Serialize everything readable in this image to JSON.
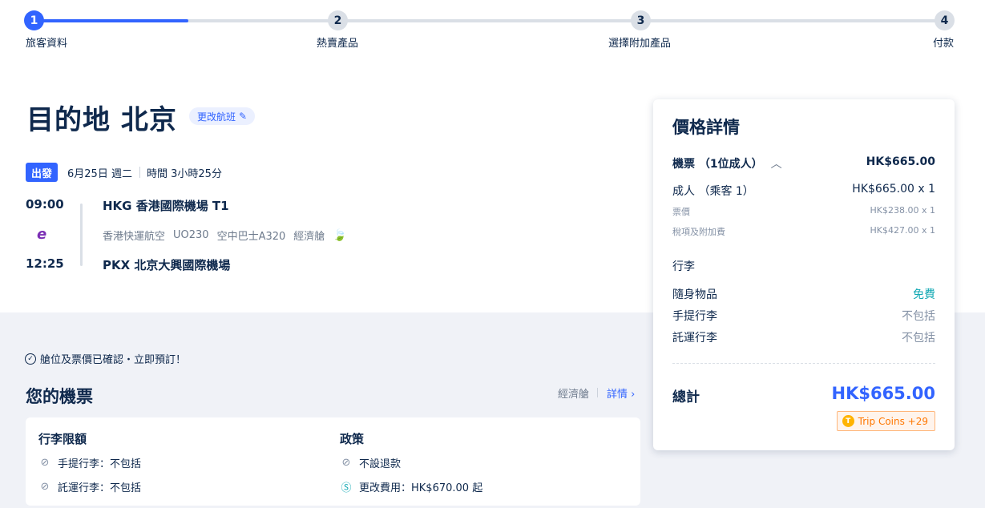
{
  "stepper": {
    "steps": [
      {
        "num": "1",
        "label": "旅客資料"
      },
      {
        "num": "2",
        "label": "熱賣產品"
      },
      {
        "num": "3",
        "label": "選擇附加產品"
      },
      {
        "num": "4",
        "label": "付款"
      }
    ],
    "progress": 0.17
  },
  "destination": {
    "title": "目的地 北京",
    "change_label": "更改航班"
  },
  "flight": {
    "depart_badge": "出發",
    "date": "6月25日 週二",
    "duration": "時間 3小時25分",
    "dep_time": "09:00",
    "arr_time": "12:25",
    "dep_airport": "HKG 香港國際機場 T1",
    "arr_airport": "PKX 北京大興國際機場",
    "airline": "香港快運航空",
    "flight_no": "UO230",
    "aircraft": "空中巴士A320",
    "cabin": "經濟艙",
    "airline_logo_text": "e"
  },
  "confirm_text": "艙位及票價已確認・立即預訂！",
  "ticket": {
    "title": "您的機票",
    "cabin": "經濟艙",
    "details_link": "詳情",
    "baggage_title": "行李限額",
    "carry_on": "手提行李：不包括",
    "checked": "託運行李：不包括",
    "policy_title": "政策",
    "refund": "不設退款",
    "change_fee": "更改費用：HK$670.00 起"
  },
  "price": {
    "title": "價格詳情",
    "ticket_label": "機票 （1位成人）",
    "ticket_total": "HK$665.00",
    "adult_label": "成人 （乘客 1）",
    "adult_value": "HK$665.00 x 1",
    "fare_label": "票價",
    "fare_value": "HK$238.00 x 1",
    "tax_label": "稅項及附加費",
    "tax_value": "HK$427.00 x 1",
    "baggage_label": "行李",
    "personal_item": "隨身物品",
    "personal_value": "免費",
    "carry_on": "手提行李",
    "carry_value": "不包括",
    "checked": "託運行李",
    "checked_value": "不包括",
    "total_label": "總計",
    "total_value": "HK$665.00",
    "coins": "Trip Coins +29"
  },
  "colors": {
    "accent": "#3264ff",
    "teal": "#10a8b3",
    "text": "#0f294d"
  }
}
